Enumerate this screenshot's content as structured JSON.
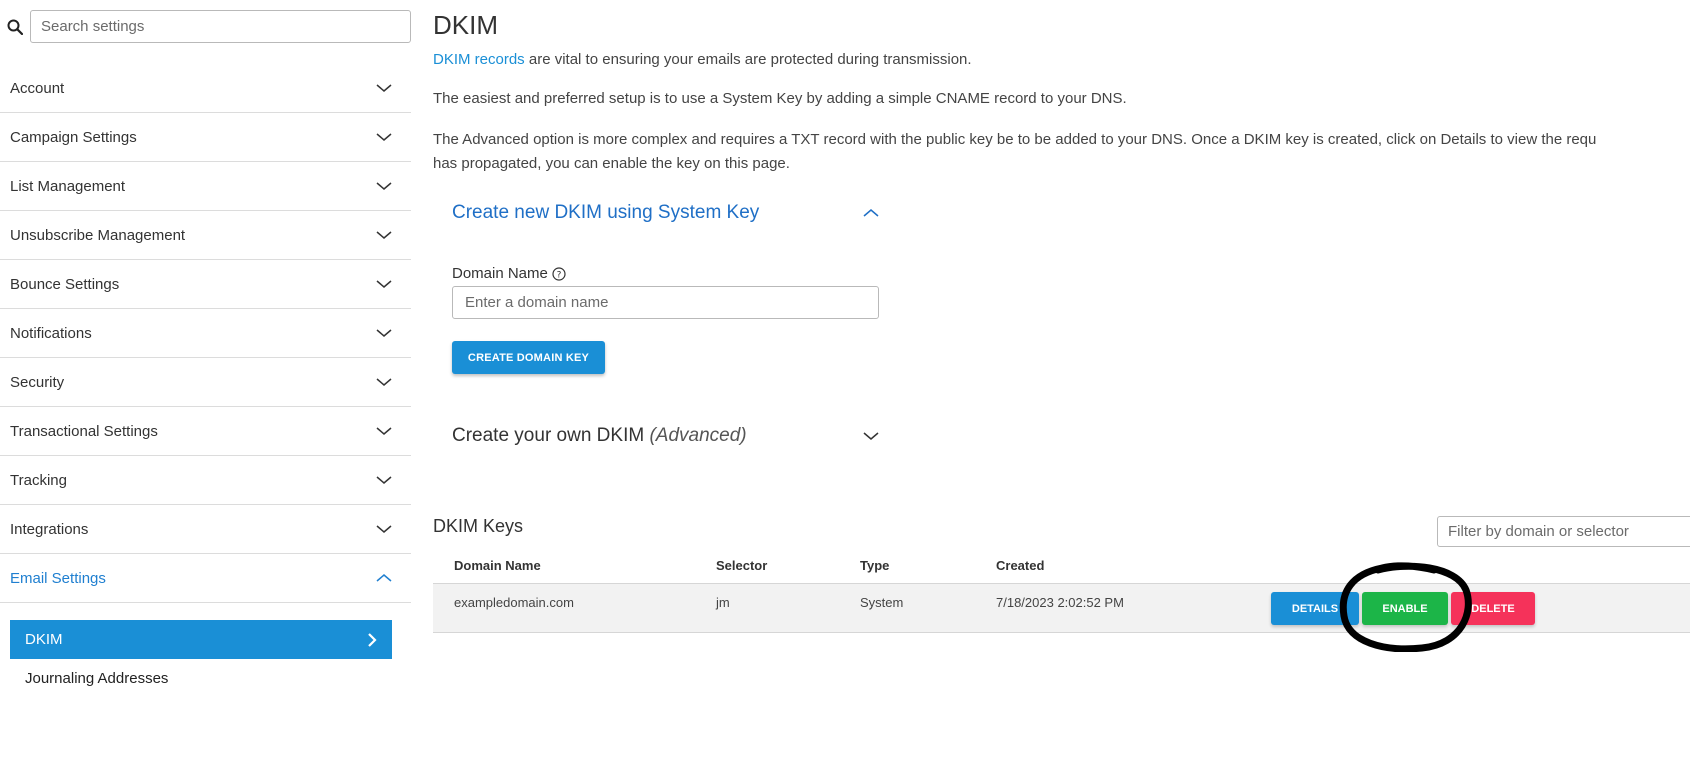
{
  "sidebar": {
    "search_placeholder": "Search settings",
    "items": [
      {
        "label": "Account",
        "icon": "chevron-down-icon"
      },
      {
        "label": "Campaign Settings",
        "icon": "chevron-down-icon"
      },
      {
        "label": "List Management",
        "icon": "chevron-down-icon"
      },
      {
        "label": "Unsubscribe Management",
        "icon": "chevron-down-icon"
      },
      {
        "label": "Bounce Settings",
        "icon": "chevron-down-icon"
      },
      {
        "label": "Notifications",
        "icon": "chevron-down-icon"
      },
      {
        "label": "Security",
        "icon": "chevron-down-icon"
      },
      {
        "label": "Transactional Settings",
        "icon": "chevron-down-icon"
      },
      {
        "label": "Tracking",
        "icon": "chevron-down-icon"
      },
      {
        "label": "Integrations",
        "icon": "chevron-down-icon"
      },
      {
        "label": "Email Settings",
        "icon": "chevron-up-icon",
        "active": true
      }
    ],
    "subitems": [
      {
        "label": "DKIM",
        "active": true
      },
      {
        "label": "Journaling Addresses"
      }
    ]
  },
  "main": {
    "title": "DKIM",
    "intro_link": "DKIM records",
    "intro_rest": " are vital to ensuring your emails are protected during transmission.",
    "p2": "The easiest and preferred setup is to use a System Key by adding a simple CNAME record to your DNS.",
    "p3_line1": "The Advanced option is more complex and requires a TXT record with the public key be to be added to your DNS. Once a DKIM key is created, click on Details to view the requ",
    "p3_line2": "has propagated, you can enable the key on this page.",
    "system_section": {
      "title": "Create new DKIM using System Key",
      "domain_label": "Domain Name",
      "domain_placeholder": "Enter a domain name",
      "create_button": "CREATE DOMAIN KEY"
    },
    "advanced_section": {
      "title": "Create your own DKIM",
      "title_em": "(Advanced)"
    },
    "keys": {
      "title": "DKIM Keys",
      "filter_placeholder": "Filter by domain or selector",
      "columns": [
        "Domain Name",
        "Selector",
        "Type",
        "Created"
      ],
      "rows": [
        {
          "domain": "exampledomain.com",
          "selector": "jm",
          "type": "System",
          "created": "7/18/2023 2:02:52 PM"
        }
      ],
      "buttons": {
        "details": "DETAILS",
        "enable": "ENABLE",
        "delete": "DELETE"
      }
    }
  },
  "colors": {
    "accent": "#1a8fd6",
    "link": "#1f6fc6",
    "enable": "#1cb548",
    "delete": "#f5325a",
    "annotation": "#000000"
  }
}
